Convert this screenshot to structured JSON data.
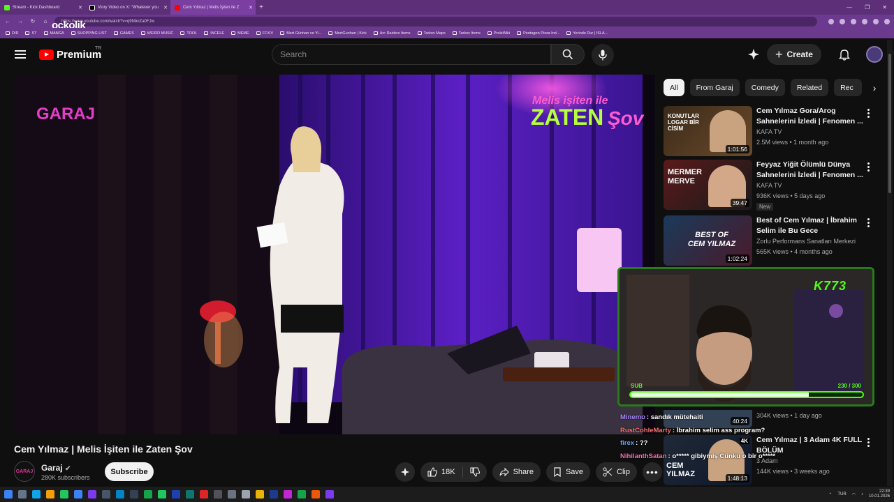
{
  "browser": {
    "tabs": [
      {
        "title": "Stream - Kick Dashboard",
        "color": "#53fc18"
      },
      {
        "title": "Viory Video on X: \"Whatever you",
        "color": "#ffffff"
      },
      {
        "title": "Cem Yılmaz | Melis İşiten ile Z",
        "color": "#ff0000"
      }
    ],
    "url": "https://www.youtube.com/watch?v=q9NbnZa0FJw",
    "bookmarks": [
      "DIR",
      "ST",
      "MANGA",
      "SHOPPING LIST",
      "GAMES",
      "WEIRD MUSIC",
      "TOOL",
      "INCELE",
      "MEME",
      "FFXIV",
      "Mert Günhan ve Yi...",
      "MertGunhan | Kick",
      "Arc Raiders Items",
      "Tarkov Maps",
      "Tarkov Items",
      "ProleWiki",
      "Pentagon Pizza Ind...",
      "Yerinde Dur | ISLA..."
    ],
    "overlay_logo": "ockolik"
  },
  "header": {
    "logo_text": "Premium",
    "region": "TR",
    "search_placeholder": "Search",
    "create_label": "Create"
  },
  "player": {
    "channel_badge": "GARAJ",
    "show_logo_top": "Melis işiten ile",
    "show_logo_main": "ZATEN",
    "show_logo_suffix": "Şov",
    "mug_label": "ZATEN"
  },
  "chips": [
    "All",
    "From Garaj",
    "Comedy",
    "Related",
    "Rec"
  ],
  "recommendations": [
    {
      "title": "Cem Yılmaz Gora/Arog Sahnelerini İzledi | Fenomen ...",
      "channel": "KAFA TV",
      "meta": "2.5M views • 1 month ago",
      "duration": "1:01:56",
      "thumb_text": "KONUTLAR LOGAR BİR CİSİM",
      "accent": "#c2410c"
    },
    {
      "title": "Feyyaz Yiğit Ölümlü Dünya Sahnelerini İzledi | Fenomen ...",
      "channel": "KAFA TV",
      "meta": "936K views • 5 days ago",
      "duration": "39:47",
      "badge": "New",
      "thumb_text": "MERMER MERVE",
      "accent": "#ffffff"
    },
    {
      "title": "Best of Cem Yılmaz | İbrahim Selim ile Bu Gece",
      "channel": "Zorlu Performans Sanatları Merkezi",
      "meta": "565K views • 4 months ago",
      "duration": "1:02:24",
      "thumb_text": "BEST OF CEM YILMAZ",
      "accent": "#e11d48"
    },
    {
      "title": "",
      "channel": "",
      "meta": "304K views • 1 day ago",
      "duration": "40:24",
      "thumb_text": "",
      "accent": "#334155"
    },
    {
      "title": "Cem Yılmaz | 3 Adam 4K FULL BÖLÜM",
      "channel": "3 Adam",
      "meta": "144K views • 3 weeks ago",
      "duration": "1:48:13",
      "thumb_text": "CEM YILMAZ",
      "accent": "#f1f1f1",
      "quality": "4K"
    }
  ],
  "video": {
    "title": "Cem Yılmaz | Melis İşiten ile Zaten Şov",
    "channel": "Garaj",
    "subscribers": "280K subscribers",
    "subscribe_label": "Subscribe",
    "likes": "18K",
    "share_label": "Share",
    "save_label": "Save",
    "clip_label": "Clip"
  },
  "stream_overlay": {
    "kick_tag": "K773",
    "sub_label": "SUB",
    "sub_count": "230 / 300",
    "sub_progress": 0.767,
    "chat": [
      {
        "user": "Minemo",
        "color": "#a78bfa",
        "message": "sandık mütehaiti"
      },
      {
        "user": "RustCohleMarty",
        "color": "#f87171",
        "message": "İbrahim selim ass program?"
      },
      {
        "user": "firex",
        "color": "#60a5fa",
        "message": "??",
        "badges": true
      },
      {
        "user": "NihilanthSatan",
        "color": "#f472b6",
        "message": "o***** gibiymiş Cünkü o bir o*****"
      }
    ]
  },
  "taskbar": {
    "lang": "TUR",
    "time": "22:39",
    "date": "10.01.2026"
  }
}
